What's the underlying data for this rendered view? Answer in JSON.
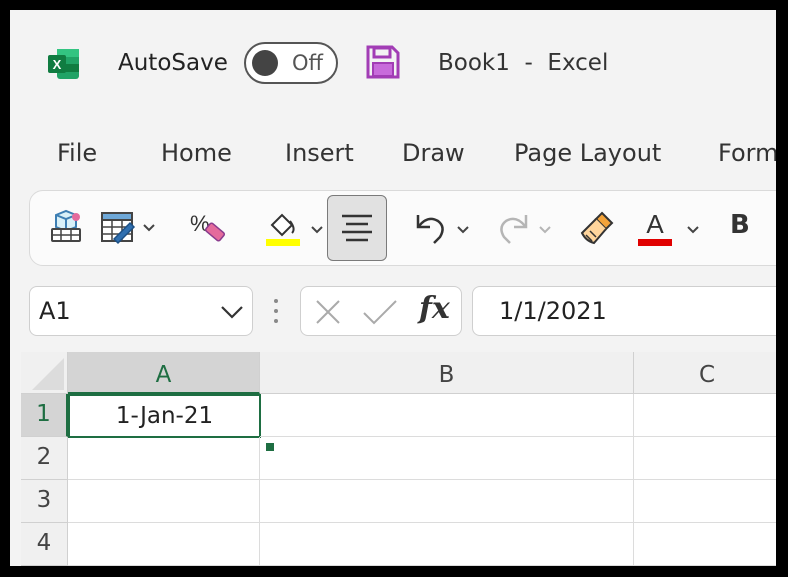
{
  "titlebar": {
    "app_icon_letter": "X",
    "autosave_label": "AutoSave",
    "autosave_state": "Off",
    "doc_title": "Book1  -  Excel"
  },
  "menu": {
    "items": [
      "File",
      "Home",
      "Insert",
      "Draw",
      "Page Layout",
      "Form"
    ]
  },
  "ribbon": {
    "icons": [
      "3d-model-icon",
      "format-table-icon",
      "percent-style-icon",
      "fill-color-icon",
      "align-center-icon",
      "undo-icon",
      "redo-icon",
      "format-painter-icon",
      "font-color-icon"
    ],
    "font_color_letter": "A",
    "bold_label": "B",
    "fill_color": "#ffff00",
    "font_color": "#e00000"
  },
  "formula_bar": {
    "name_box": "A1",
    "fx_label": "fx",
    "formula_value": "1/1/2021"
  },
  "grid": {
    "columns": [
      "A",
      "B",
      "C"
    ],
    "rows": [
      "1",
      "2",
      "3",
      "4"
    ],
    "cells": {
      "A1": "1-Jan-21"
    },
    "active_cell": "A1",
    "accent": "#1e6e42"
  }
}
